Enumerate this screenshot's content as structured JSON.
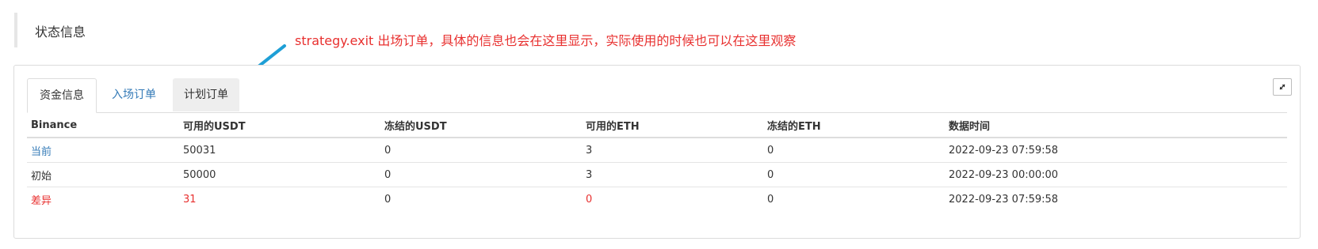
{
  "section": {
    "title": "状态信息"
  },
  "annotation": {
    "text": "strategy.exit 出场订单，具体的信息也会在这里显示，实际使用的时候也可以在这里观察"
  },
  "tabs": [
    {
      "label": "资金信息",
      "state": "active"
    },
    {
      "label": "入场订单",
      "state": "normal"
    },
    {
      "label": "计划订单",
      "state": "hover"
    }
  ],
  "table": {
    "headers": [
      "Binance",
      "可用的USDT",
      "冻结的USDT",
      "可用的ETH",
      "冻结的ETH",
      "数据时间"
    ],
    "rows": [
      [
        "当前",
        "50031",
        "0",
        "3",
        "0",
        "2022-09-23 07:59:58"
      ],
      [
        "初始",
        "50000",
        "0",
        "3",
        "0",
        "2022-09-23 00:00:00"
      ],
      [
        "差异",
        "31",
        "0",
        "0",
        "0",
        "2022-09-23 07:59:58"
      ]
    ]
  },
  "icons": {
    "expand": "expand-icon"
  },
  "colors": {
    "accent": "#337ab7",
    "annotation": "#e8302f",
    "arrow": "#1e9fd6"
  }
}
